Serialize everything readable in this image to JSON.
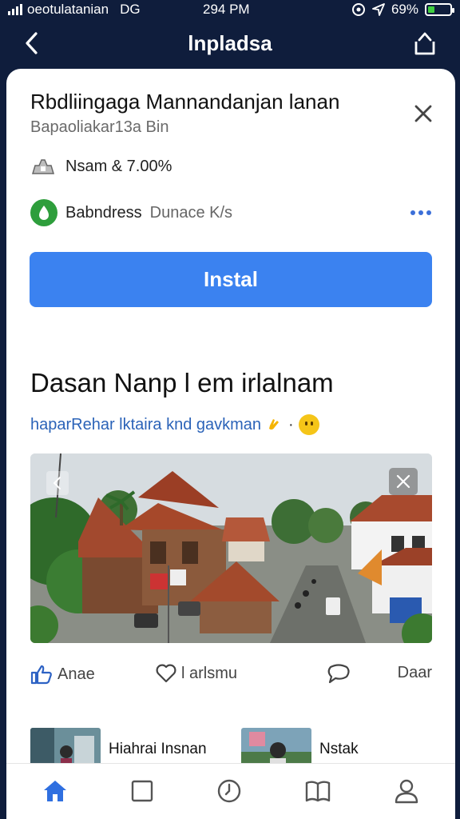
{
  "status_bar": {
    "carrier": "oeotulatanian",
    "network": "DG",
    "time": "294 PM",
    "battery": "69%",
    "battery_level": 0.3
  },
  "nav": {
    "title": "lnpladsa",
    "back_icon": "chevron-left-icon",
    "share_icon": "share-icon"
  },
  "app": {
    "title": "Rbdliingaga Mannandanjan lanan",
    "subtitle": "Bapaoliakar13a Bin",
    "rating_text": "Nsam & 7.00%",
    "developer_name": "Babndress",
    "developer_sub": "Dunace K/s",
    "install_label": "Instal"
  },
  "section": {
    "title": "Dasan Nanp l em irlalnam",
    "link_text": "haparRehar lktaira knd gavkman"
  },
  "actions": {
    "like_label": "Anae",
    "save_label": "l arlsmu",
    "share_label": "Daar"
  },
  "related": [
    {
      "title": "Hiahrai Insnan"
    },
    {
      "title": "Nstak"
    }
  ],
  "tabs": [
    {
      "name": "home",
      "icon": "home-icon"
    },
    {
      "name": "library",
      "icon": "square-icon"
    },
    {
      "name": "history",
      "icon": "clock-icon"
    },
    {
      "name": "bookmarks",
      "icon": "book-icon"
    },
    {
      "name": "profile",
      "icon": "person-icon"
    }
  ],
  "colors": {
    "header_bg": "#0f1d3c",
    "accent": "#3b82f0",
    "link": "#2b63b8",
    "active_tab": "#2f6fe0"
  }
}
